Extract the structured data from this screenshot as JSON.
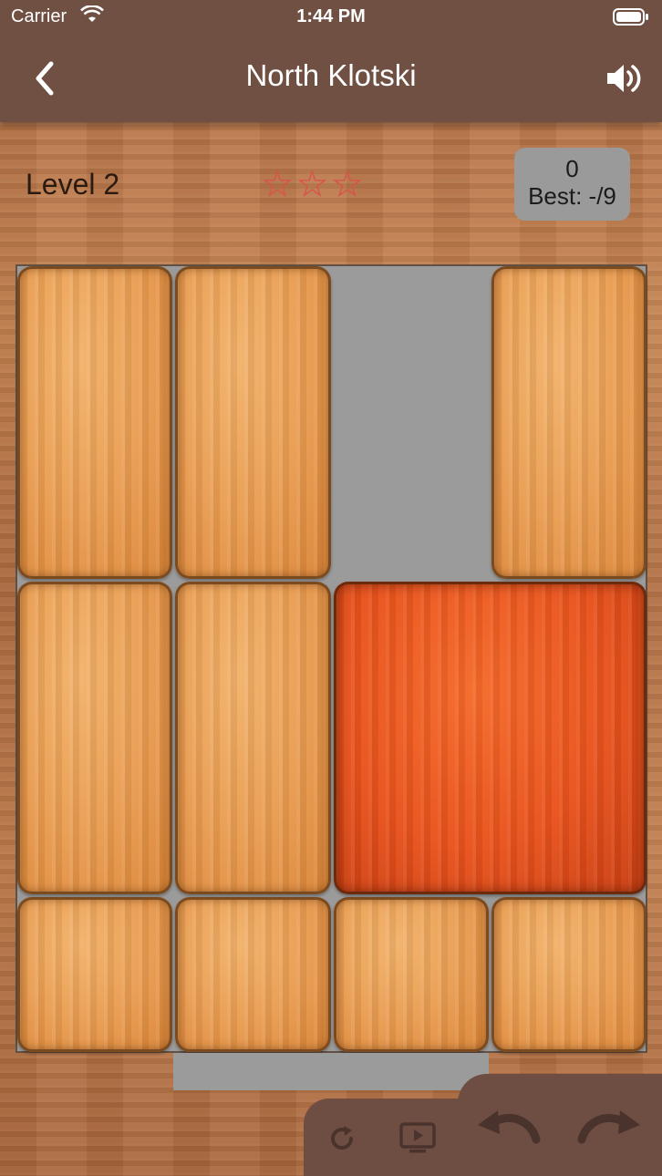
{
  "status_bar": {
    "carrier": "Carrier",
    "time": "1:44 PM"
  },
  "nav": {
    "title": "North Klotski"
  },
  "game": {
    "level": "Level 2",
    "stars_earned": 0,
    "stars_total": 3,
    "moves": "0",
    "best": "Best: -/9"
  },
  "board": {
    "columns": 4,
    "rows": 5,
    "exit_columns": [
      1,
      2
    ]
  },
  "pieces": [
    {
      "name": "block-vertical",
      "col": 0,
      "row": 0,
      "w": 1,
      "h": 2,
      "color": "#e89a4e"
    },
    {
      "name": "block-vertical",
      "col": 1,
      "row": 0,
      "w": 1,
      "h": 2,
      "color": "#e89a4e"
    },
    {
      "name": "block-vertical",
      "col": 3,
      "row": 0,
      "w": 1,
      "h": 2,
      "color": "#e89a4e"
    },
    {
      "name": "block-vertical",
      "col": 0,
      "row": 2,
      "w": 1,
      "h": 2,
      "color": "#e89a4e"
    },
    {
      "name": "block-vertical",
      "col": 1,
      "row": 2,
      "w": 1,
      "h": 2,
      "color": "#e89a4e"
    },
    {
      "name": "block-target-red",
      "col": 2,
      "row": 2,
      "w": 2,
      "h": 2,
      "color": "#e8521c"
    },
    {
      "name": "block-small",
      "col": 0,
      "row": 4,
      "w": 1,
      "h": 1,
      "color": "#e89a4e"
    },
    {
      "name": "block-small",
      "col": 1,
      "row": 4,
      "w": 1,
      "h": 1,
      "color": "#e89a4e"
    },
    {
      "name": "block-small",
      "col": 2,
      "row": 4,
      "w": 1,
      "h": 1,
      "color": "#e89a4e"
    },
    {
      "name": "block-small",
      "col": 3,
      "row": 4,
      "w": 1,
      "h": 1,
      "color": "#e89a4e"
    }
  ],
  "icons": {
    "back": "chevron-left-icon",
    "sound": "speaker-icon",
    "restart": "restart-icon",
    "video": "video-hint-icon",
    "undo": "undo-icon",
    "redo": "redo-icon"
  },
  "colors": {
    "nav_bar": "#715044",
    "board": "#9b9b9b",
    "star_outline": "#d9534a"
  }
}
